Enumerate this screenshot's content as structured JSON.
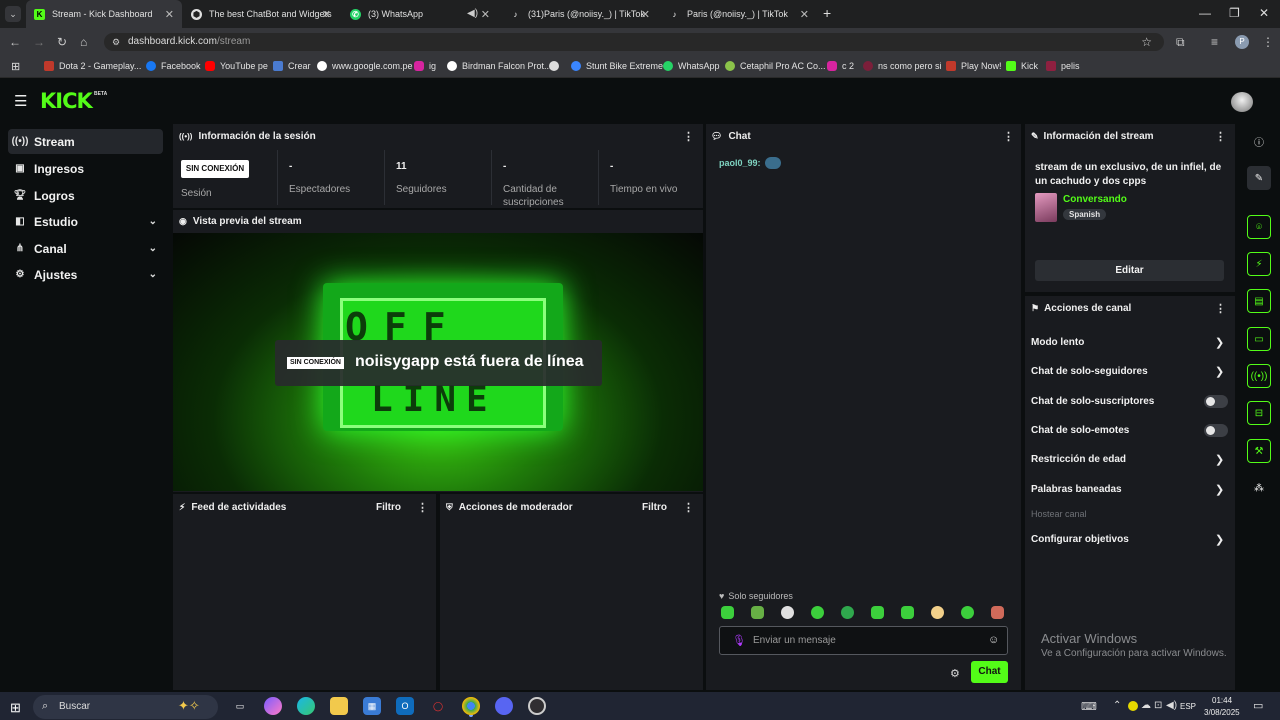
{
  "browser": {
    "tabs": [
      {
        "label": "Stream - Kick Dashboard",
        "active": true
      },
      {
        "label": "The best ChatBot and Widgets"
      },
      {
        "label": "(3) WhatsApp"
      },
      {
        "label": "(31)Paris (@noiisy._) | TikTok"
      },
      {
        "label": "Paris (@noiisy._) | TikTok"
      }
    ],
    "new_tab": "+",
    "address": {
      "domain": "dashboard.kick.com",
      "path": "/stream"
    },
    "profile_initial": "P",
    "bookmarks": [
      {
        "label": "Dota 2 - Gameplay...",
        "color": "#c0392b"
      },
      {
        "label": "Facebook",
        "color": "#1877f2"
      },
      {
        "label": "YouTube pe",
        "color": "#ff0000"
      },
      {
        "label": "Crear",
        "color": "#4a7bd0"
      },
      {
        "label": "www.google.com.pe",
        "color": "#ffffff"
      },
      {
        "label": "ig",
        "color": "#d6249f"
      },
      {
        "label": "Birdman Falcon Prot...",
        "color": "#ffffff"
      },
      {
        "label": "",
        "color": "#dddddd"
      },
      {
        "label": "Stunt Bike Extreme",
        "color": "#3a86ff"
      },
      {
        "label": "WhatsApp",
        "color": "#25d366"
      },
      {
        "label": "Cetaphil Pro AC Co...",
        "color": "#8bc34a"
      },
      {
        "label": "c 2",
        "color": "#d6249f"
      },
      {
        "label": "ns como pero si",
        "color": "#7b1f3a"
      },
      {
        "label": "Play Now!",
        "color": "#c0392b"
      },
      {
        "label": "Kick",
        "color": "#53fc18"
      },
      {
        "label": "pelis",
        "color": "#8e2040"
      }
    ]
  },
  "kick": {
    "logo": "KICK",
    "beta": "BETA",
    "sidebar": [
      {
        "label": "Stream",
        "icon": "broadcast-icon",
        "active": true
      },
      {
        "label": "Ingresos",
        "icon": "wallet-icon"
      },
      {
        "label": "Logros",
        "icon": "trophy-icon"
      },
      {
        "label": "Estudio",
        "icon": "layers-icon",
        "chev": "⌄"
      },
      {
        "label": "Canal",
        "icon": "share-icon",
        "chev": "⌄"
      },
      {
        "label": "Ajustes",
        "icon": "gear-icon",
        "chev": "⌄"
      }
    ],
    "session": {
      "title": "Información de la sesión",
      "badge": "SIN CONEXIÓN",
      "stats": [
        {
          "value": "",
          "label": "Sesión"
        },
        {
          "value": "-",
          "label": "Espectadores"
        },
        {
          "value": "11",
          "label": "Seguidores"
        },
        {
          "value": "-",
          "label": "Cantidad de suscripciones"
        },
        {
          "value": "-",
          "label": "Tiempo en vivo"
        }
      ]
    },
    "preview": {
      "title": "Vista previa del stream",
      "badge": "SIN CONEXIÓN",
      "message": "noiisygapp está fuera de línea",
      "screen_top": "OFF",
      "screen_bottom": "LINE"
    },
    "feed": {
      "title": "Feed de actividades",
      "filter": "Filtro"
    },
    "mod": {
      "title": "Acciones de moderador",
      "filter": "Filtro"
    },
    "chat": {
      "title": "Chat",
      "message_user": "paol0_99:",
      "followers_only": "Solo seguidores",
      "placeholder": "Enviar un mensaje",
      "send": "Chat"
    },
    "stream_info": {
      "title": "Información del stream",
      "stream_title": "stream de un exclusivo, de un infiel, de un cachudo y dos cpps",
      "category": "Conversando",
      "language": "Spanish",
      "edit": "Editar"
    },
    "channel_actions": {
      "title": "Acciones de canal",
      "items": [
        {
          "label": "Modo lento",
          "kind": "arrow"
        },
        {
          "label": "Chat de solo-seguidores",
          "kind": "arrow"
        },
        {
          "label": "Chat de solo-suscriptores",
          "kind": "toggle",
          "on": false
        },
        {
          "label": "Chat de solo-emotes",
          "kind": "toggle",
          "on": false
        },
        {
          "label": "Restricción de edad",
          "kind": "arrow"
        },
        {
          "label": "Palabras baneadas",
          "kind": "arrow"
        },
        {
          "label": "Hostear canal",
          "kind": "disabled"
        },
        {
          "label": "Configurar objetivos",
          "kind": "arrow"
        }
      ]
    },
    "watermark": {
      "line1": "Activar Windows",
      "line2": "Ve a Configuración para activar Windows."
    }
  },
  "taskbar": {
    "search": "Buscar",
    "lang": "ESP",
    "time": "01:44",
    "date": "3/08/2025"
  },
  "colors": {
    "accent": "#53fc18",
    "panel": "#191b1f",
    "bg": "#0b0e0f"
  }
}
